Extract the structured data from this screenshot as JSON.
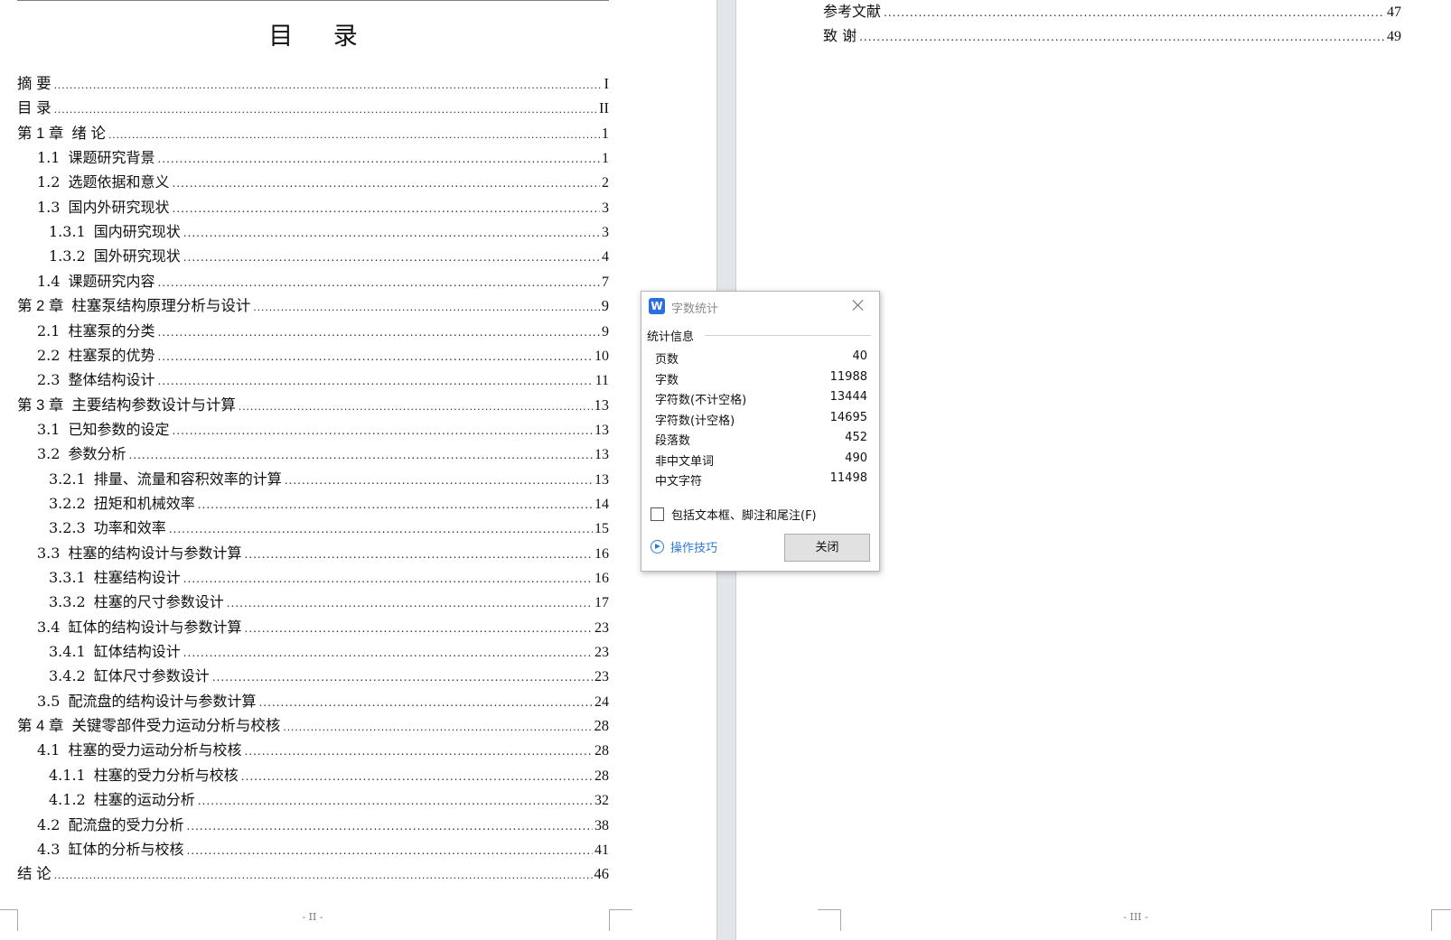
{
  "left_page": {
    "title": "目 录",
    "entries": [
      {
        "num": "摘  要",
        "label": "",
        "page": "I"
      },
      {
        "num": "目  录",
        "label": "",
        "page": "II"
      },
      {
        "num": "第 1 章",
        "label": "绪  论",
        "page": "1"
      },
      {
        "num": "1.1",
        "label": "课题研究背景",
        "page": "1"
      },
      {
        "num": "1.2",
        "label": "选题依据和意义",
        "page": "2"
      },
      {
        "num": "1.3",
        "label": "国内外研究现状",
        "page": "3"
      },
      {
        "num": "1.3.1",
        "label": "国内研究现状",
        "page": "3"
      },
      {
        "num": "1.3.2",
        "label": "国外研究现状",
        "page": "4"
      },
      {
        "num": "1.4",
        "label": "课题研究内容",
        "page": "7"
      },
      {
        "num": "第 2 章",
        "label": "柱塞泵结构原理分析与设计",
        "page": "9"
      },
      {
        "num": "2.1",
        "label": "柱塞泵的分类",
        "page": "9"
      },
      {
        "num": "2.2",
        "label": "柱塞泵的优势",
        "page": "10"
      },
      {
        "num": "2.3",
        "label": "整体结构设计",
        "page": "11"
      },
      {
        "num": "第 3 章",
        "label": "主要结构参数设计与计算",
        "page": "13"
      },
      {
        "num": "3.1",
        "label": "已知参数的设定",
        "page": "13"
      },
      {
        "num": "3.2",
        "label": "参数分析",
        "page": "13"
      },
      {
        "num": "3.2.1",
        "label": "排量、流量和容积效率的计算",
        "page": "13"
      },
      {
        "num": "3.2.2",
        "label": "扭矩和机械效率",
        "page": "14"
      },
      {
        "num": "3.2.3",
        "label": "功率和效率",
        "page": "15"
      },
      {
        "num": "3.3",
        "label": "柱塞的结构设计与参数计算",
        "page": "16"
      },
      {
        "num": "3.3.1",
        "label": "柱塞结构设计",
        "page": "16"
      },
      {
        "num": "3.3.2",
        "label": "柱塞的尺寸参数设计",
        "page": "17"
      },
      {
        "num": "3.4",
        "label": "缸体的结构设计与参数计算",
        "page": "23"
      },
      {
        "num": "3.4.1",
        "label": "缸体结构设计",
        "page": "23"
      },
      {
        "num": "3.4.2",
        "label": "缸体尺寸参数设计",
        "page": "23"
      },
      {
        "num": "3.5",
        "label": "配流盘的结构设计与参数计算",
        "page": "24"
      },
      {
        "num": "第 4 章",
        "label": "关键零部件受力运动分析与校核",
        "page": "28"
      },
      {
        "num": "4.1",
        "label": "柱塞的受力运动分析与校核",
        "page": "28"
      },
      {
        "num": "4.1.1",
        "label": "柱塞的受力分析与校核",
        "page": "28"
      },
      {
        "num": "4.1.2",
        "label": "柱塞的运动分析",
        "page": "32"
      },
      {
        "num": "4.2",
        "label": "配流盘的受力分析",
        "page": "38"
      },
      {
        "num": "4.3",
        "label": "缸体的分析与校核",
        "page": "41"
      },
      {
        "num": "结  论",
        "label": "",
        "page": "46"
      }
    ],
    "footer": "- II -"
  },
  "right_page": {
    "entries": [
      {
        "num": "参考文献",
        "label": "",
        "page": "47"
      },
      {
        "num": "致  谢",
        "label": "",
        "page": "49"
      }
    ],
    "footer": "- III -"
  },
  "dialog": {
    "title": "字数统计",
    "app_icon": "W",
    "section_label": "统计信息",
    "stats": [
      {
        "label": "页数",
        "value": "40"
      },
      {
        "label": "字数",
        "value": "11988"
      },
      {
        "label": "字符数(不计空格)",
        "value": "13444"
      },
      {
        "label": "字符数(计空格)",
        "value": "14695"
      },
      {
        "label": "段落数",
        "value": "452"
      },
      {
        "label": "非中文单词",
        "value": "490"
      },
      {
        "label": "中文字符",
        "value": "11498"
      }
    ],
    "checkbox_label": "包括文本框、脚注和尾注(F)",
    "tips_label": "操作技巧",
    "close_label": "关闭"
  }
}
